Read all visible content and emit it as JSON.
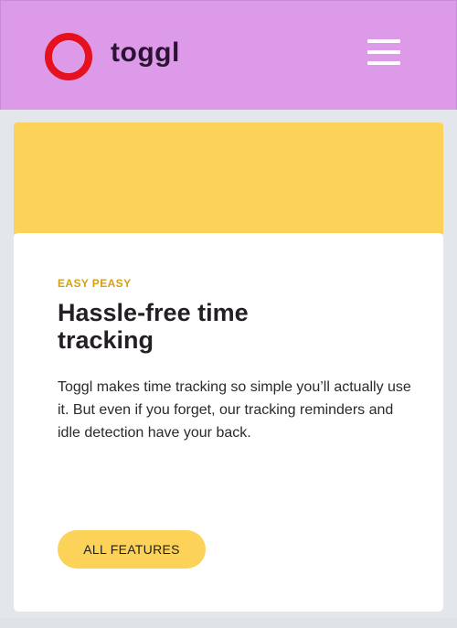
{
  "header": {
    "brand": "toggl",
    "logo_icon": "toggl-ring-logo",
    "menu_icon": "hamburger-menu-icon"
  },
  "feature_card": {
    "eyebrow": "EASY PEASY",
    "heading": "Hassle-free time tracking",
    "body": "Toggl makes time tracking so simple you’ll actually use it. But even if you forget, our tracking reminders and idle detection have your back.",
    "cta_label": "ALL FEATURES"
  },
  "colors": {
    "header_bg": "#dd9ae9",
    "accent_yellow": "#fdd258",
    "eyebrow": "#d59f10",
    "logo_red": "#e5111f"
  }
}
